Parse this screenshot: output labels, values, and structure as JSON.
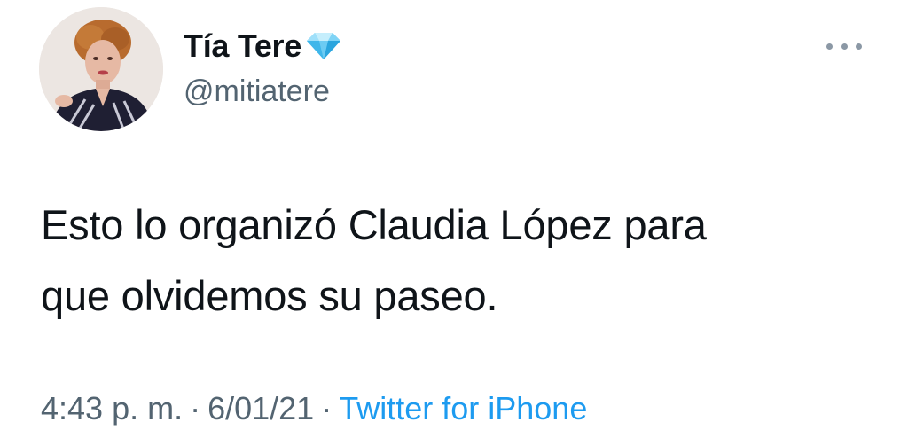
{
  "author": {
    "display_name": "Tía Tere",
    "handle": "@mitiatere",
    "badge_icon": "blue-diamond-icon",
    "avatar_icon": "profile-photo"
  },
  "menu": {
    "icon": "more-options-icon"
  },
  "tweet": {
    "text_line1": "Esto lo organizó Claudia López para",
    "text_line2": "que olvidemos su paseo."
  },
  "meta": {
    "time": "4:43 p. m.",
    "separator": "·",
    "date": "6/01/21",
    "source": "Twitter for iPhone"
  },
  "colors": {
    "text": "#0f1419",
    "secondary": "#536471",
    "link": "#1d9bf0",
    "background": "#ffffff"
  }
}
